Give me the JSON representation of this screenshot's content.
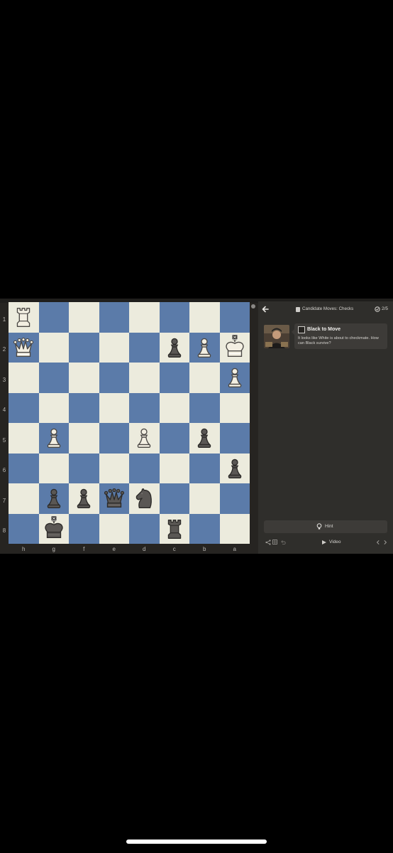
{
  "app": {
    "accent_board_dark": "#5b7ba9",
    "accent_board_light": "#ecebdd"
  },
  "board": {
    "orientation": "black-bottom",
    "rank_labels": [
      "1",
      "2",
      "3",
      "4",
      "5",
      "6",
      "7",
      "8"
    ],
    "file_labels": [
      "h",
      "g",
      "f",
      "e",
      "d",
      "c",
      "b",
      "a"
    ],
    "pieces": [
      {
        "square": "h1",
        "piece": "rook",
        "color": "white"
      },
      {
        "square": "h2",
        "piece": "queen",
        "color": "white"
      },
      {
        "square": "c2",
        "piece": "pawn",
        "color": "black"
      },
      {
        "square": "b2",
        "piece": "pawn",
        "color": "white"
      },
      {
        "square": "a2",
        "piece": "king",
        "color": "white",
        "checkmark_icon": true
      },
      {
        "square": "a3",
        "piece": "pawn",
        "color": "white"
      },
      {
        "square": "g5",
        "piece": "pawn",
        "color": "white"
      },
      {
        "square": "d5",
        "piece": "pawn",
        "color": "white"
      },
      {
        "square": "b5",
        "piece": "pawn",
        "color": "black"
      },
      {
        "square": "a6",
        "piece": "pawn",
        "color": "black"
      },
      {
        "square": "g7",
        "piece": "pawn",
        "color": "black"
      },
      {
        "square": "f7",
        "piece": "pawn",
        "color": "black"
      },
      {
        "square": "e7",
        "piece": "queen",
        "color": "black"
      },
      {
        "square": "d7",
        "piece": "knight",
        "color": "black"
      },
      {
        "square": "g8",
        "piece": "king",
        "color": "black",
        "checkmark_icon": true
      },
      {
        "square": "c8",
        "piece": "rook",
        "color": "black"
      }
    ]
  },
  "panel": {
    "lesson_title": "Candidate Moves: Checks",
    "progress": "2/5",
    "to_move_title": "Black to Move",
    "prompt": "It looks like White is about to checkmate. How can Black survive?",
    "hint_label": "Hint",
    "video_label": "Video"
  }
}
